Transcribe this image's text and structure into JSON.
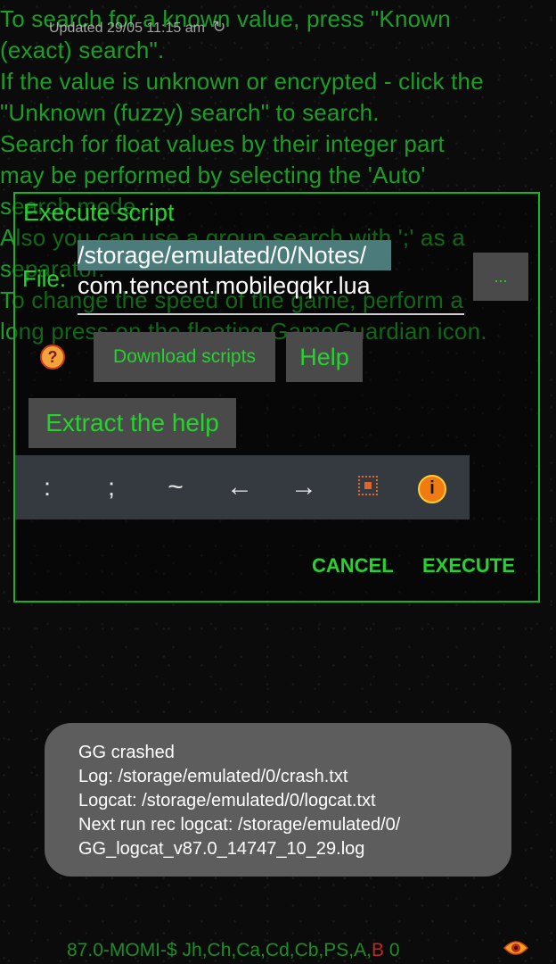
{
  "background_help": {
    "lines": [
      "To search for a known value, press \"Known",
      "(exact) search\".",
      "If the value is unknown or encrypted - click the",
      "\"Unknown (fuzzy) search\" to search.",
      "Search for float values by their integer part",
      "may be performed by selecting the 'Auto'",
      "search mode.",
      "Also you can use a group search with ';' as a",
      "separator.",
      "To change the speed of the game, perform a",
      "long press on the floating GameGuardian icon."
    ]
  },
  "updated": {
    "text": "Updated 29/05 11:15 am"
  },
  "dialog": {
    "title": "Execute script",
    "file_label": "File:",
    "file_path_line1": "/storage/emulated/0/Notes/",
    "file_path_line2": "com.tencent.mobileqqkr.lua",
    "browse_label": "...",
    "download_label": "Download scripts",
    "help_label": "Help",
    "extract_label": "Extract the help",
    "keys": [
      ":",
      ";",
      "~",
      "←",
      "→"
    ],
    "cancel_label": "CANCEL",
    "execute_label": "EXECUTE"
  },
  "toast": {
    "lines": [
      "GG crashed",
      "Log: /storage/emulated/0/crash.txt",
      "Logcat: /storage/emulated/0/logcat.txt",
      "Next run rec logcat: /storage/emulated/0/",
      "GG_logcat_v87.0_14747_10_29.log"
    ]
  },
  "statusbar": {
    "prefix": "87.0-MOMI-$",
    "flags": " Jh,Ch,Ca,Cd,Cb,PS,A,",
    "red_flag": "B",
    "count": " 0"
  },
  "colors": {
    "accent_green": "#25d32e",
    "button_gray": "#4a4a4a",
    "keybar": "#343a40",
    "toast": "#5d5d5d"
  }
}
